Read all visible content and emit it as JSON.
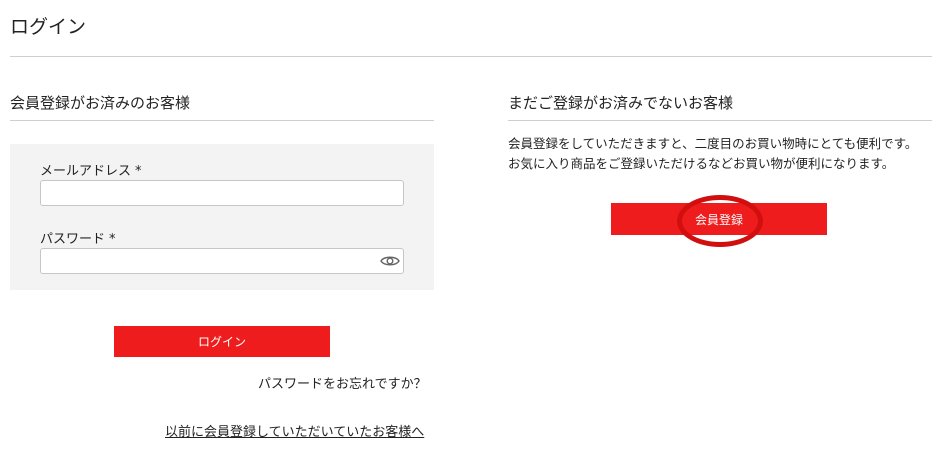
{
  "page": {
    "title": "ログイン"
  },
  "member": {
    "heading": "会員登録がお済みのお客様",
    "email_label": "メールアドレス",
    "password_label": "パスワード",
    "required_mark": "*",
    "email_value": "",
    "password_value": "",
    "login_button": "ログイン",
    "forgot_link": "パスワードをお忘れですか？",
    "legacy_link": "以前に会員登録していただいていたお客様へ"
  },
  "guest": {
    "heading": "まだご登録がお済みでないお客様",
    "desc_line1": "会員登録をしていただきますと、二度目のお買い物時にとても便利です。",
    "desc_line2": "お気に入り商品をご登録いただけるなどお買い物が便利になります。",
    "register_button": "会員登録"
  },
  "colors": {
    "accent": "#ee1c1c",
    "annotation": "#d10f0f"
  },
  "icons": {
    "password_toggle": "eye-icon"
  }
}
